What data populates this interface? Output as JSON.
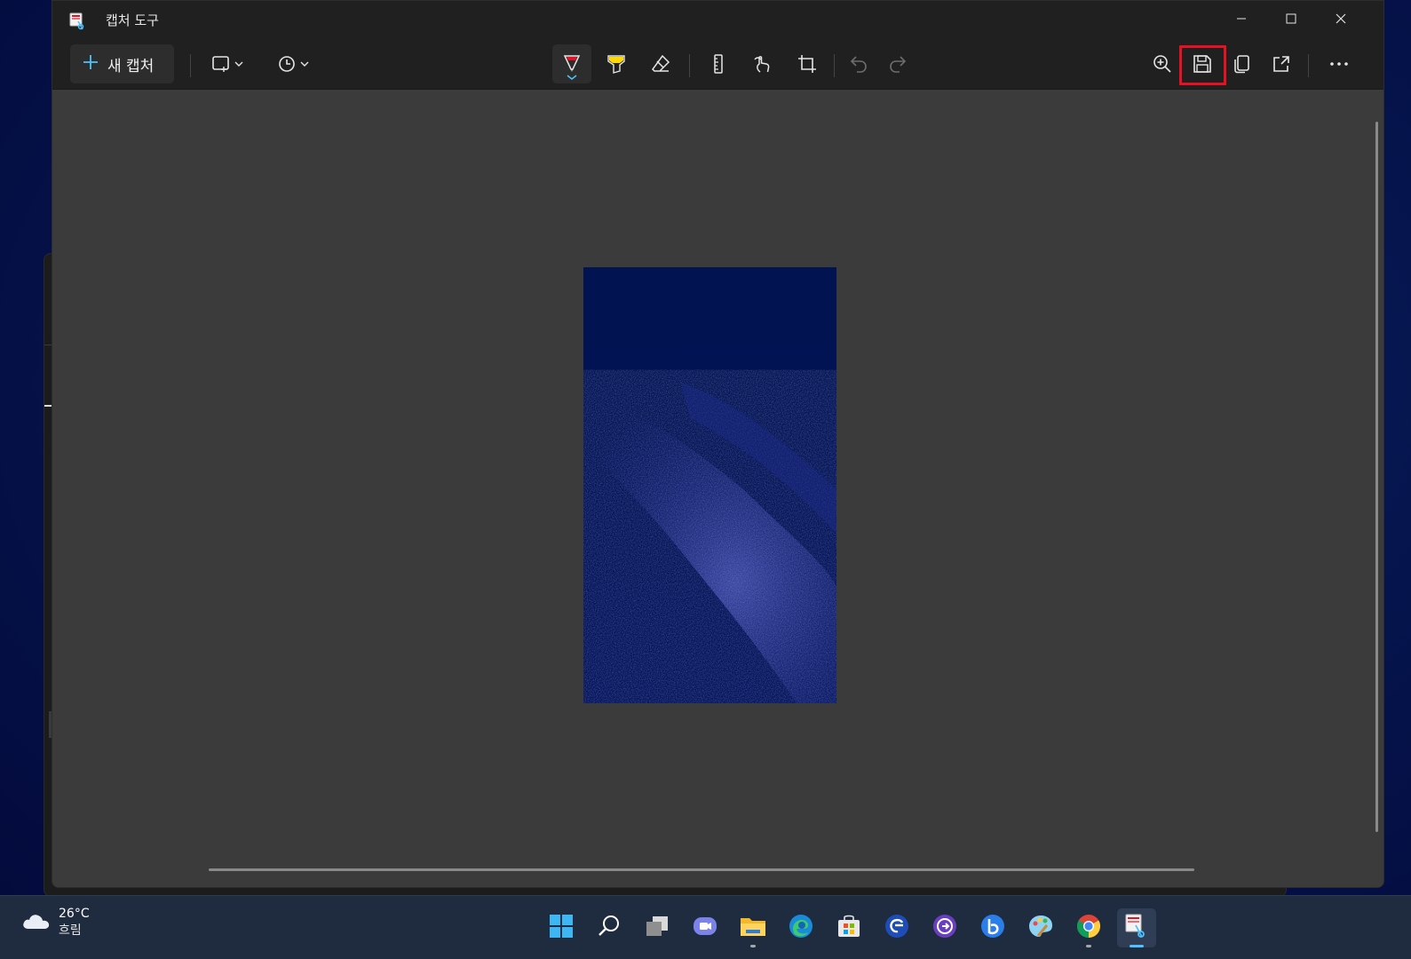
{
  "window": {
    "title": "캡처 도구",
    "minimize_icon": "minimize-icon",
    "maximize_icon": "maximize-icon",
    "close_icon": "close-icon"
  },
  "toolbar": {
    "new_capture_label": "새 캡처",
    "mode_icon": "rectangle-snip-icon",
    "delay_icon": "clock-icon",
    "tools": [
      "ballpoint-pen",
      "highlighter",
      "eraser",
      "ruler",
      "touch-writing",
      "crop",
      "undo",
      "redo"
    ],
    "right_tools": [
      "zoom-in",
      "save",
      "copy",
      "share",
      "more"
    ],
    "highlight_color": "#e81123",
    "pen_color": "#e81123",
    "highlighter_color": "#ffd800"
  },
  "taskbar": {
    "weather_temp": "26°C",
    "weather_desc": "흐림",
    "apps": [
      "start",
      "search",
      "task-view",
      "chat",
      "file-explorer",
      "edge",
      "store",
      "app-8",
      "app-9",
      "app-10",
      "paint",
      "chrome",
      "snipping-tool"
    ]
  },
  "colors": {
    "accent": "#4cc2ff",
    "window_bg": "#202020",
    "canvas_bg": "#3b3b3b"
  }
}
